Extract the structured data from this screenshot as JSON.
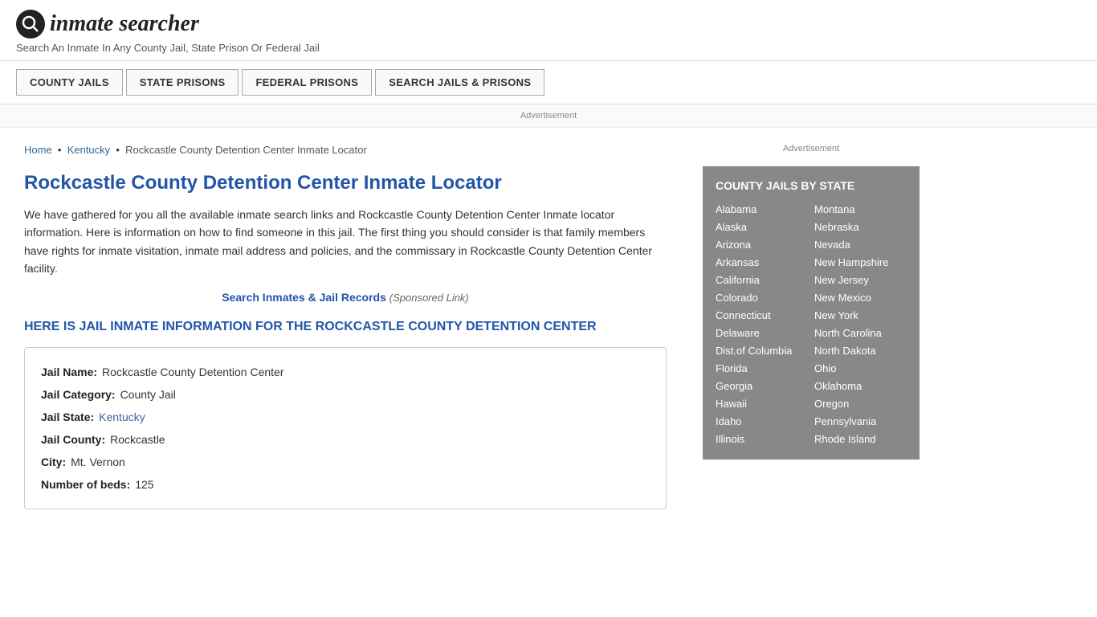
{
  "header": {
    "logo_icon": "🔍",
    "logo_text": "inmate searcher",
    "tagline": "Search An Inmate In Any County Jail, State Prison Or Federal Jail"
  },
  "nav": {
    "buttons": [
      {
        "id": "county-jails",
        "label": "COUNTY JAILS"
      },
      {
        "id": "state-prisons",
        "label": "STATE PRISONS"
      },
      {
        "id": "federal-prisons",
        "label": "FEDERAL PRISONS"
      },
      {
        "id": "search-jails",
        "label": "SEARCH JAILS & PRISONS"
      }
    ]
  },
  "ad": {
    "banner_label": "Advertisement"
  },
  "breadcrumb": {
    "home": "Home",
    "state": "Kentucky",
    "current": "Rockcastle County Detention Center Inmate Locator"
  },
  "main": {
    "page_title": "Rockcastle County Detention Center Inmate Locator",
    "intro_text": "We have gathered for you all the available inmate search links and Rockcastle County Detention Center Inmate locator information. Here is information on how to find someone in this jail. The first thing you should consider is that family members have rights for inmate visitation, inmate mail address and policies, and the commissary in Rockcastle County Detention Center facility.",
    "sponsored_link_text": "Search Inmates & Jail Records",
    "sponsored_label": "(Sponsored Link)",
    "section_heading": "HERE IS JAIL INMATE INFORMATION FOR THE ROCKCASTLE COUNTY DETENTION CENTER",
    "info": {
      "jail_name_label": "Jail Name:",
      "jail_name_value": "Rockcastle County Detention Center",
      "jail_category_label": "Jail Category:",
      "jail_category_value": "County Jail",
      "jail_state_label": "Jail State:",
      "jail_state_value": "Kentucky",
      "jail_county_label": "Jail County:",
      "jail_county_value": "Rockcastle",
      "city_label": "City:",
      "city_value": "Mt. Vernon",
      "num_beds_label": "Number of beds:",
      "num_beds_value": "125"
    }
  },
  "sidebar": {
    "ad_label": "Advertisement",
    "county_jails_title": "COUNTY JAILS BY STATE",
    "states_col1": [
      "Alabama",
      "Alaska",
      "Arizona",
      "Arkansas",
      "California",
      "Colorado",
      "Connecticut",
      "Delaware",
      "Dist.of Columbia",
      "Florida",
      "Georgia",
      "Hawaii",
      "Idaho",
      "Illinois"
    ],
    "states_col2": [
      "Montana",
      "Nebraska",
      "Nevada",
      "New Hampshire",
      "New Jersey",
      "New Mexico",
      "New York",
      "North Carolina",
      "North Dakota",
      "Ohio",
      "Oklahoma",
      "Oregon",
      "Pennsylvania",
      "Rhode Island"
    ]
  }
}
